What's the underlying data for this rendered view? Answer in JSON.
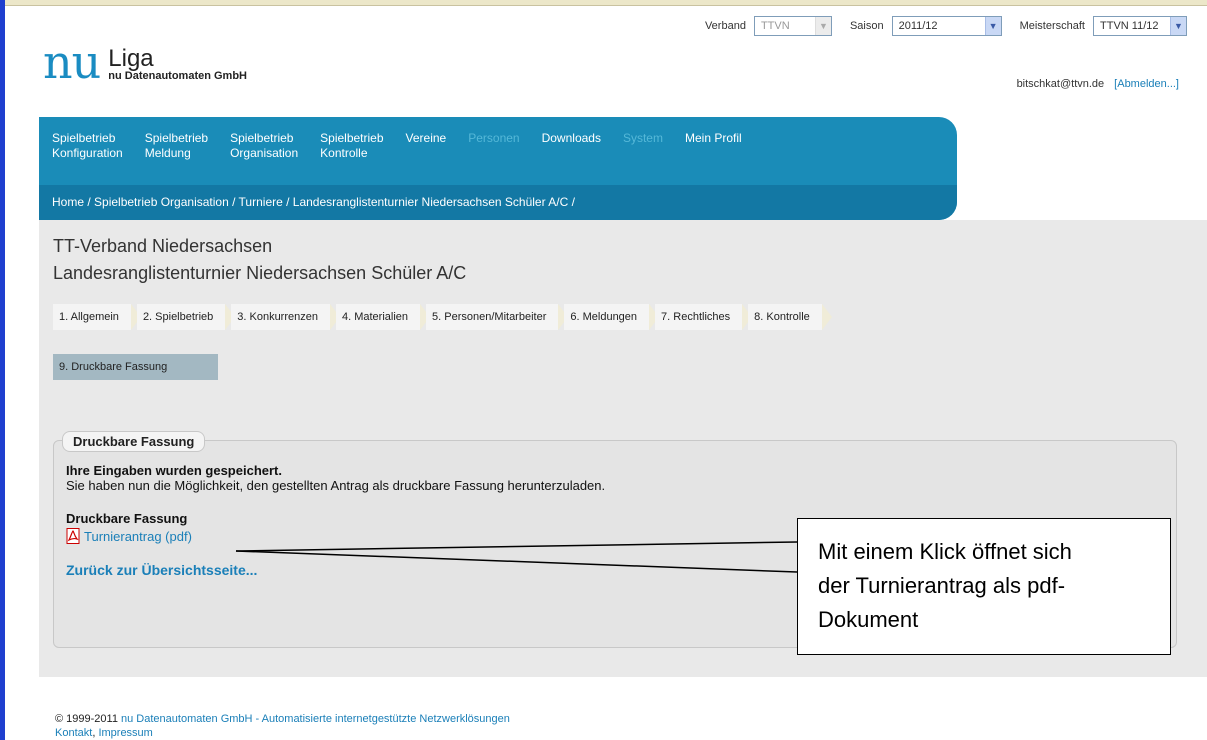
{
  "topbar": {
    "verband_label": "Verband",
    "verband_value": "TTVN",
    "saison_label": "Saison",
    "saison_value": "2011/12",
    "meisterschaft_label": "Meisterschaft",
    "meisterschaft_value": "TTVN 11/12"
  },
  "logo": {
    "nu": "nu",
    "liga": "Liga",
    "sub": "nu Datenautomaten GmbH"
  },
  "user": {
    "email": "bitschkat@ttvn.de",
    "logout": "[Abmelden...]"
  },
  "nav": {
    "items": [
      {
        "line1": "Spielbetrieb",
        "line2": "Konfiguration"
      },
      {
        "line1": "Spielbetrieb",
        "line2": "Meldung"
      },
      {
        "line1": "Spielbetrieb",
        "line2": "Organisation"
      },
      {
        "line1": "Spielbetrieb",
        "line2": "Kontrolle"
      },
      {
        "line1": "Vereine",
        "line2": ""
      },
      {
        "line1": "Personen",
        "line2": ""
      },
      {
        "line1": "Downloads",
        "line2": ""
      },
      {
        "line1": "System",
        "line2": ""
      },
      {
        "line1": "Mein Profil",
        "line2": ""
      }
    ],
    "breadcrumb": "Home / Spielbetrieb Organisation / Turniere / Landesranglistenturnier Niedersachsen Schüler A/C /"
  },
  "titles": {
    "org": "TT-Verband Niedersachsen",
    "tournament": "Landesranglistenturnier Niedersachsen Schüler A/C"
  },
  "steps": [
    "1. Allgemein",
    "2. Spielbetrieb",
    "3. Konkurrenzen",
    "4. Materialien",
    "5. Personen/Mitarbeiter",
    "6. Meldungen",
    "7. Rechtliches",
    "8. Kontrolle"
  ],
  "active_step": "9. Druckbare Fassung",
  "fieldset": {
    "legend": "Druckbare Fassung",
    "saved_heading": "Ihre Eingaben wurden gespeichert.",
    "saved_text": "Sie haben nun die Möglichkeit, den gestellten Antrag als druckbare Fassung herunterzuladen.",
    "download_heading": "Druckbare Fassung",
    "pdf_link": "Turnierantrag (pdf)",
    "back_link": "Zurück zur Übersichtsseite..."
  },
  "footer": {
    "copyright": "© 1999-2011",
    "company_link": "nu Datenautomaten GmbH - Automatisierte internetgestützte Netzwerklösungen",
    "kontakt": "Kontakt",
    "impressum": "Impressum"
  },
  "callout": {
    "line1": "Mit einem Klick öffnet sich",
    "line2": "der Turnierantrag als pdf-",
    "line3": "Dokument"
  },
  "colors": {
    "nav_blue": "#1a8cb8",
    "crumb_blue": "#1378a4",
    "link_blue": "#1a7fb8",
    "left_bar": "#1f3fcf",
    "active_step": "#a3b8c2"
  },
  "icons": [
    "chevron-down-icon",
    "pdf-icon"
  ]
}
